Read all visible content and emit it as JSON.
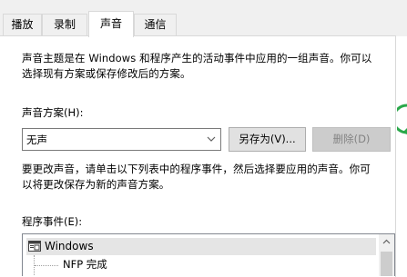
{
  "tabs": [
    {
      "label": "播放",
      "active": false
    },
    {
      "label": "录制",
      "active": false
    },
    {
      "label": "声音",
      "active": true
    },
    {
      "label": "通信",
      "active": false
    }
  ],
  "intro": {
    "line1": "声音主题是在 Windows 和程序产生的活动事件中应用的一组声音。你可以",
    "line2": "选择现有方案或保存修改后的方案。"
  },
  "scheme": {
    "label": "声音方案(H):",
    "selected": "无声",
    "save_as_label": "另存为(V)...",
    "delete_label": "删除(D)"
  },
  "instructions": {
    "line1": "要更改声音，请单击以下列表中的程序事件，然后选择要应用的声音。你可",
    "line2": "以将更改保存为新的声音方案。"
  },
  "events": {
    "label": "程序事件(E):",
    "category": "Windows",
    "items": [
      "NFP 完成"
    ]
  },
  "colors": {
    "accent_green": "#2aa84a",
    "selection_gray": "#e5e5e5",
    "disabled_button": "#cccccc"
  },
  "icons": {
    "combo": "chevron-down-icon",
    "category": "windows-app-icon",
    "scroll": "arrow-up-icon"
  }
}
